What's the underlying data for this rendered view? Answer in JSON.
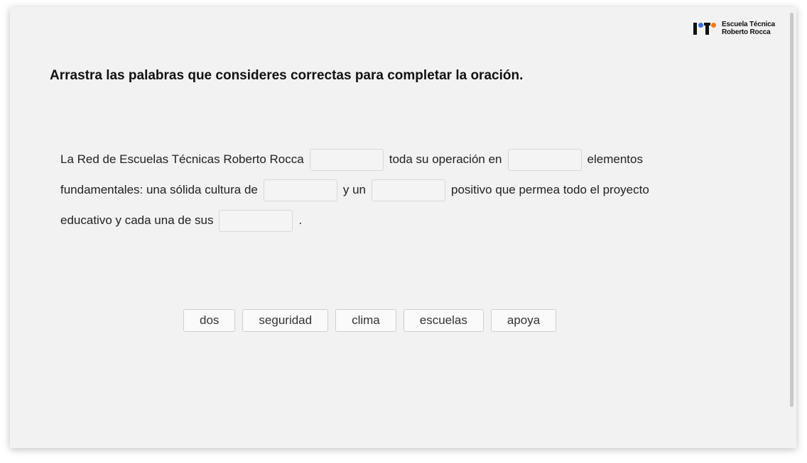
{
  "logo": {
    "line1": "Escuela Técnica",
    "line2": "Roberto Rocca"
  },
  "instruction": "Arrastra las palabras que consideres correctas para completar la oración.",
  "sentence": {
    "line1": {
      "part1": "La Red de Escuelas Técnicas Roberto Rocca",
      "part2": "toda su operación en",
      "part3": "elementos"
    },
    "line2": {
      "part1": "fundamentales: una sólida cultura de",
      "part2": "y un",
      "part3": "positivo que permea todo el proyecto"
    },
    "line3": {
      "part1": "educativo y cada una de sus",
      "part2": "."
    }
  },
  "word_bank": [
    "dos",
    "seguridad",
    "clima",
    "escuelas",
    "apoya"
  ]
}
